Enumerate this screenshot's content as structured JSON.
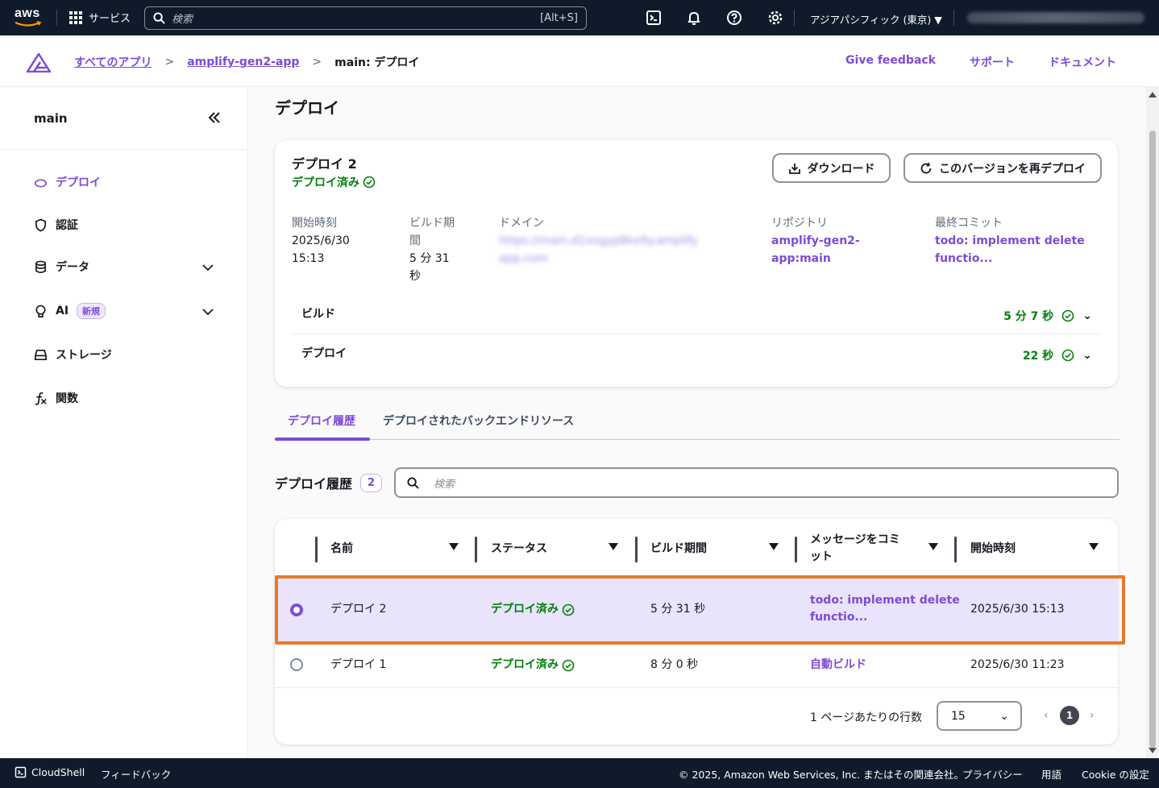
{
  "topnav": {
    "logo_text": "aws",
    "services_label": "サービス",
    "search_placeholder": "検索",
    "search_shortcut": "[Alt+S]",
    "region": "アジアパシフィック (東京) ▼"
  },
  "header": {
    "breadcrumbs": [
      "すべてのアプリ",
      "amplify-gen2-app",
      "main: デプロイ"
    ],
    "links": [
      "Give feedback",
      "サポート",
      "ドキュメント"
    ]
  },
  "sidebar": {
    "title": "main",
    "items": [
      {
        "label": "デプロイ"
      },
      {
        "label": "認証"
      },
      {
        "label": "データ"
      },
      {
        "label": "AI",
        "badge": "新規"
      },
      {
        "label": "ストレージ"
      },
      {
        "label": "関数"
      }
    ]
  },
  "main": {
    "title": "デプロイ",
    "deploy": {
      "name": "デプロイ 2",
      "status": "デプロイ済み",
      "download_label": "ダウンロード",
      "redeploy_label": "このバージョンを再デプロイ",
      "start_label": "開始時刻",
      "start_date": "2025/6/30",
      "start_time": "15:13",
      "build_duration_label_1": "ビルド期",
      "build_duration_label_2": "間",
      "build_duration_1": "5 分 31",
      "build_duration_2": "秒",
      "domain_label": "ドメイン",
      "domain_value_1": "https://main.d1xxgyp8kx9y.amplify",
      "domain_value_2": "app.com",
      "repo_label": "リポジトリ",
      "repo_value_1": "amplify-gen2-",
      "repo_value_2": "app:main",
      "commit_label": "最終コミット",
      "commit_value_1": "todo: implement delete",
      "commit_value_2": "functio...",
      "build_row_label": "ビルド",
      "build_row_time": "5 分 7 秒",
      "deploy_row_label": "デプロイ",
      "deploy_row_time": "22 秒"
    },
    "tabs": [
      "デプロイ履歴",
      "デプロイされたバックエンドリソース"
    ],
    "history": {
      "title": "デプロイ履歴",
      "count": "2",
      "search_placeholder": "検索",
      "columns": [
        "名前",
        "ステータス",
        "ビルド期間",
        "メッセージをコミ",
        "ット",
        "開始時刻"
      ],
      "rows": [
        {
          "name": "デプロイ 2",
          "status": "デプロイ済み",
          "duration": "5 分 31 秒",
          "commit_1": "todo: implement delete",
          "commit_2": "functio...",
          "start": "2025/6/30 15:13",
          "selected": true
        },
        {
          "name": "デプロイ 1",
          "status": "デプロイ済み",
          "duration": "8 分 0 秒",
          "commit_1": "自動ビルド",
          "commit_2": "",
          "start": "2025/6/30 11:23",
          "selected": false
        }
      ],
      "rows_per_page_label": "1 ページあたりの行数",
      "rows_per_page": "15",
      "current_page": "1"
    }
  },
  "footer": {
    "cloudshell": "CloudShell",
    "feedback": "フィードバック",
    "copyright": "© 2025, Amazon Web Services, Inc. またはその関連会社。",
    "privacy": "プライバシー",
    "terms": "用語",
    "cookie": "Cookie の設定"
  },
  "colors": {
    "accent": "#7d4bd8",
    "success": "#037f0c",
    "nav_bg": "#0f1b2a",
    "selection_outline": "#e8792b"
  }
}
